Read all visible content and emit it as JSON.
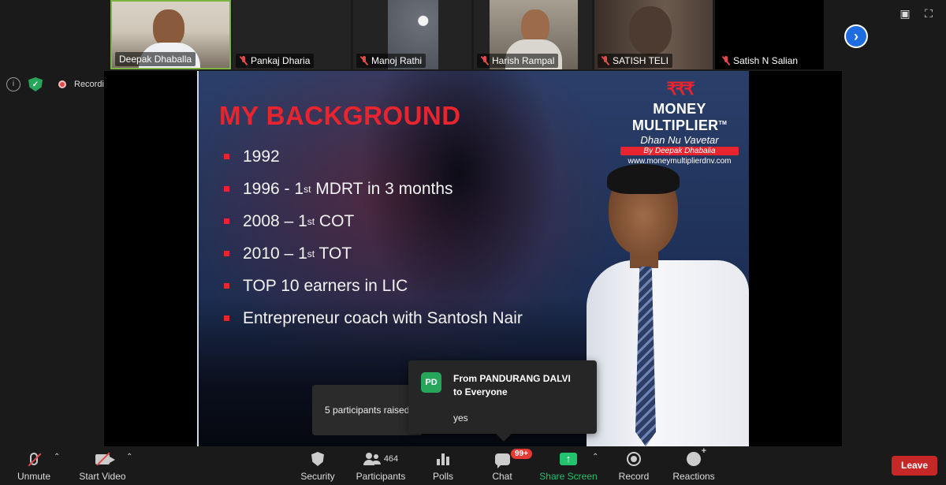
{
  "gallery": {
    "participants": [
      {
        "name": "Deepak Dhaballa",
        "muted": false,
        "video": true
      },
      {
        "name": "Pankaj Dharia",
        "muted": true,
        "video": false
      },
      {
        "name": "Manoj Rathi",
        "muted": true,
        "video": true
      },
      {
        "name": "Harish Rampal",
        "muted": true,
        "video": true
      },
      {
        "name": "SATISH TELI",
        "muted": true,
        "video": true
      },
      {
        "name": "Satish N Salian",
        "muted": true,
        "video": false
      }
    ]
  },
  "status": {
    "recording_label": "Recording"
  },
  "slide": {
    "title": "MY BACKGROUND",
    "bullets": [
      {
        "text": "1992"
      },
      {
        "text_pre": "1996 - 1",
        "sup": "st",
        "text_post": " MDRT in 3 months"
      },
      {
        "text_pre": "2008 – 1",
        "sup": "st",
        "text_post": " COT"
      },
      {
        "text_pre": "2010 – 1",
        "sup": "st",
        "text_post": " TOT"
      },
      {
        "text": "TOP 10 earners in LIC"
      },
      {
        "text": "Entrepreneur coach with Santosh Nair"
      }
    ],
    "logo": {
      "rupees": "₹₹₹",
      "brand": "MONEY MULTIPLIER",
      "tm": "TM",
      "tagline": "Dhan Nu Vavetar",
      "by": "By Deepak Dhabalia",
      "url": "www.moneymultiplierdnv.com"
    }
  },
  "raise_toast": {
    "text": "5 participants raised"
  },
  "chat_popup": {
    "avatar_initials": "PD",
    "from_line1": "From PANDURANG DALVI",
    "from_line2": "to Everyone",
    "message": "yes"
  },
  "toolbar": {
    "unmute": "Unmute",
    "start_video": "Start Video",
    "security": "Security",
    "participants": "Participants",
    "participants_count": "464",
    "polls": "Polls",
    "chat": "Chat",
    "chat_badge": "99+",
    "share_screen": "Share Screen",
    "record": "Record",
    "reactions": "Reactions",
    "leave": "Leave"
  },
  "colors": {
    "accent_green": "#23c26d",
    "leave_red": "#c62828",
    "slide_red": "#e8252e",
    "nav_blue": "#1e6ce0"
  }
}
